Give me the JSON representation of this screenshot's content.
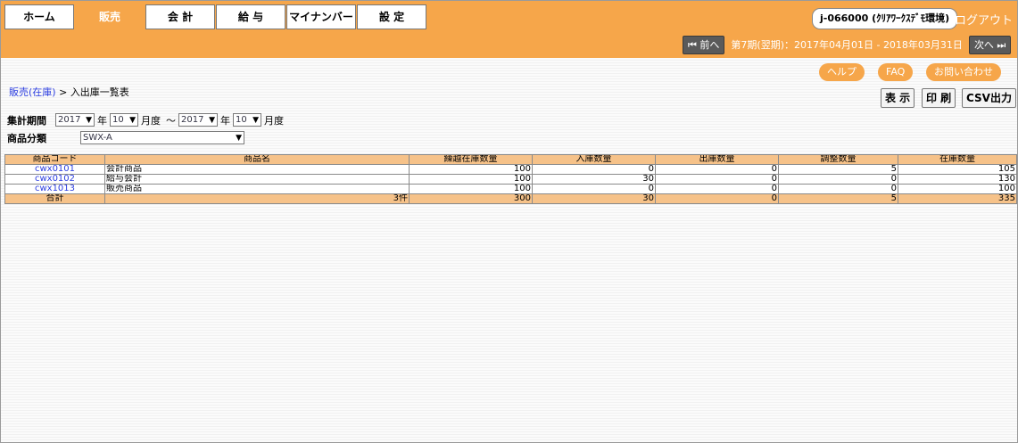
{
  "tabs": [
    "ホーム",
    "販売",
    "会 計",
    "給 与",
    "マイナンバー",
    "設 定"
  ],
  "user_label": "j-066000 (ｸﾘｱﾜｰｸｽﾃﾞﾓ環境)",
  "logout_label": "ログアウト",
  "period": {
    "prev_label": "⏮ 前へ",
    "text": "第7期(翌期)：2017年04月01日 - 2018年03月31日",
    "next_label": "次へ ⏭"
  },
  "help_links": {
    "help": "ヘルプ",
    "faq": "FAQ",
    "contact": "お問い合わせ"
  },
  "breadcrumb": {
    "parent": "販売(在庫)",
    "separator": " > ",
    "current": "入出庫一覧表"
  },
  "actions": {
    "show": "表 示",
    "print": "印 刷",
    "csv": "CSV出力"
  },
  "filters": {
    "period_label": "集計期間",
    "from_year": "2017",
    "from_month": "10",
    "to_year": "2017",
    "to_month": "10",
    "year_unit": "年",
    "month_unit": "月度",
    "tilde": "～",
    "category_label": "商品分類",
    "category_value": "SWX-A"
  },
  "table": {
    "headers": [
      "商品コード",
      "商品名",
      "繰越在庫数量",
      "入庫数量",
      "出庫数量",
      "調整数量",
      "在庫数量"
    ],
    "rows": [
      {
        "code": "cwx0101",
        "name": "会計商品",
        "carry": "100",
        "in": "0",
        "out": "0",
        "adj": "5",
        "stock": "105"
      },
      {
        "code": "cwx0102",
        "name": "給与会計",
        "carry": "100",
        "in": "30",
        "out": "0",
        "adj": "0",
        "stock": "130"
      },
      {
        "code": "cwx1013",
        "name": "販売商品",
        "carry": "100",
        "in": "0",
        "out": "0",
        "adj": "0",
        "stock": "100"
      }
    ],
    "total": {
      "label": "合計",
      "count": "3件",
      "carry": "300",
      "in": "30",
      "out": "0",
      "adj": "5",
      "stock": "335"
    }
  }
}
